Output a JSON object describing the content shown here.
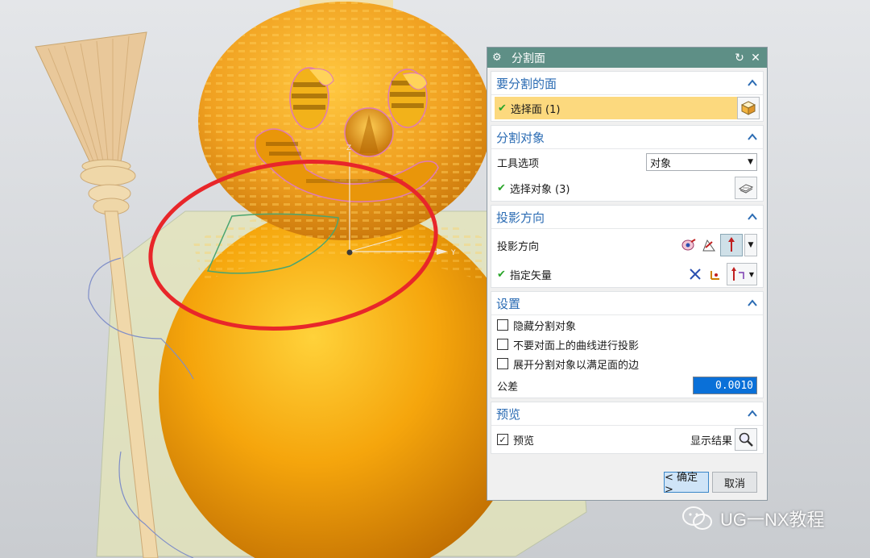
{
  "dialog": {
    "title": "分割面",
    "reset_icon": "reset-icon",
    "close_icon": "close-icon",
    "groups": {
      "face_to_split": {
        "header": "要分割的面",
        "select_face_label": "选择面 (1)"
      },
      "split_objects": {
        "header": "分割对象",
        "tool_option_label": "工具选项",
        "tool_option_value": "对象",
        "select_object_label": "选择对象 (3)"
      },
      "projection": {
        "header": "投影方向",
        "direction_label": "投影方向",
        "vector_label": "指定矢量"
      },
      "settings": {
        "header": "设置",
        "hide_split_objects": "隐藏分割对象",
        "no_project_curves": "不要对面上的曲线进行投影",
        "expand_split_objects": "展开分割对象以满足面的边",
        "tolerance_label": "公差",
        "tolerance_value": "0.0010"
      },
      "preview": {
        "header": "预览",
        "preview_label": "预览",
        "preview_checked": true,
        "show_result_label": "显示结果"
      }
    },
    "ok_label": "< 确定 >",
    "cancel_label": "取消"
  },
  "viewport": {
    "axis_z": "Z",
    "axis_y": "Y"
  },
  "watermark": {
    "text": "UG一NX教程"
  },
  "colors": {
    "title_bar": "#5e8f86",
    "group_header_text": "#2a6bb3",
    "selected_row": "#fcd97e",
    "highlight_field": "#0a70d8",
    "gourd": "#f2a20a",
    "annotation_circle": "#e8262a"
  }
}
